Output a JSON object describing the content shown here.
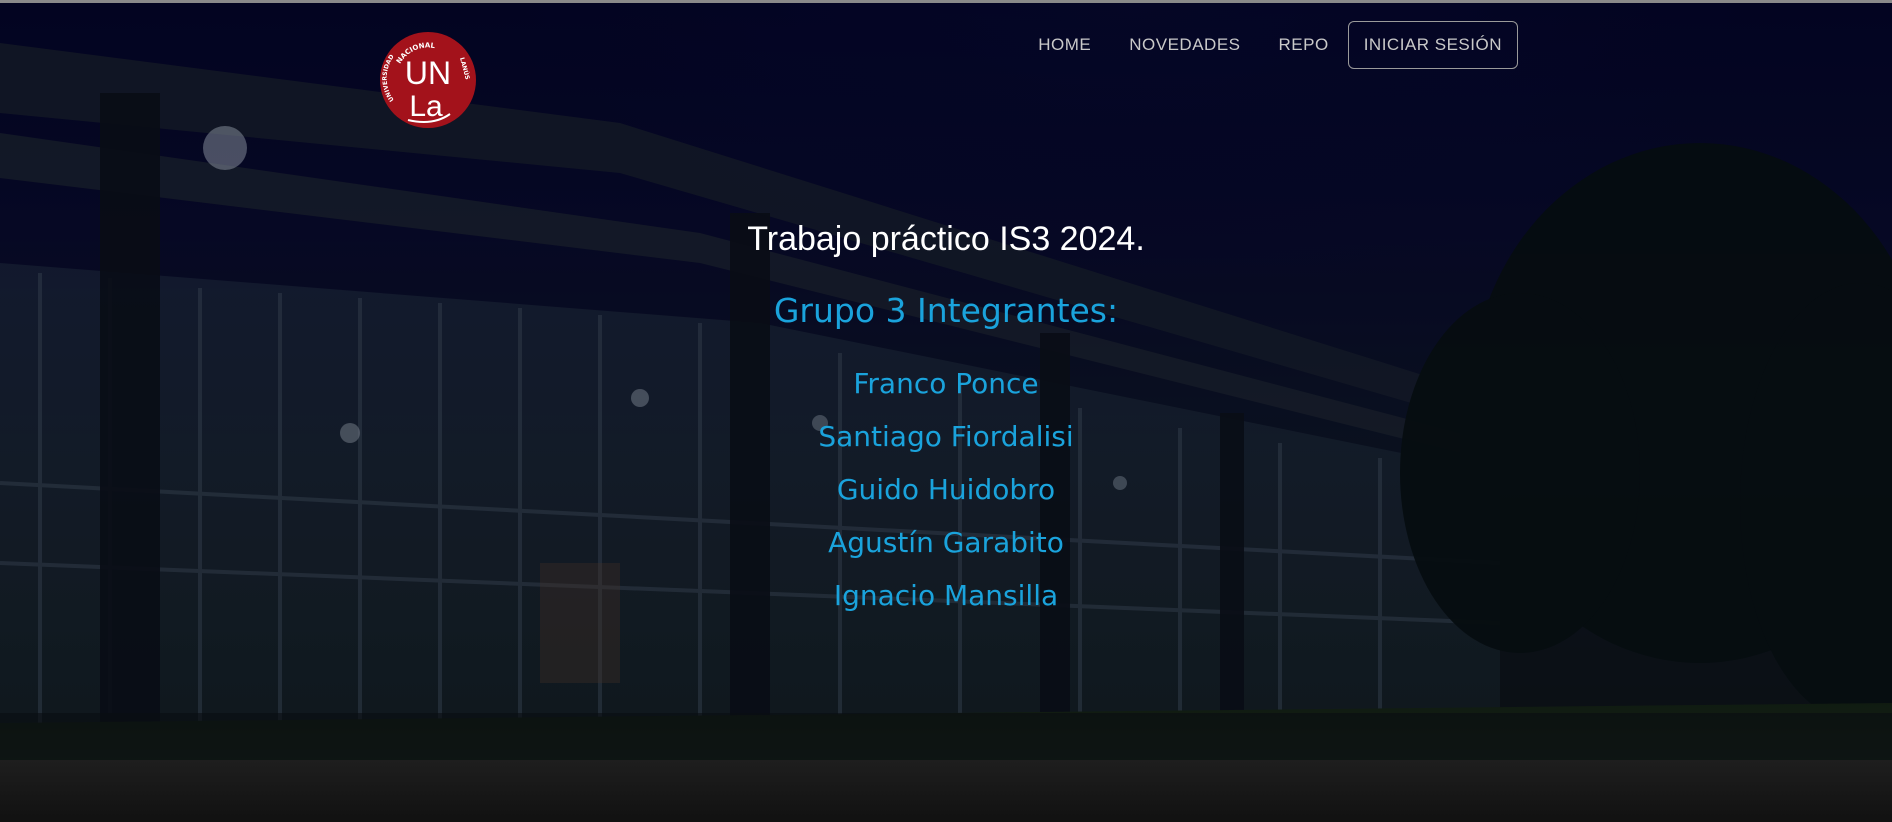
{
  "logo": {
    "letters_top": "UN",
    "letters_bottom": "La",
    "arc_left": "UNIVERSIDAD",
    "arc_top": "NACIONAL",
    "arc_right": "LANÚS",
    "color": "#a3121b"
  },
  "nav": {
    "items": [
      {
        "label": "HOME"
      },
      {
        "label": "NOVEDADES"
      },
      {
        "label": "REPO"
      }
    ],
    "login_label": "INICIAR SESIÓN"
  },
  "hero": {
    "title": "Trabajo práctico IS3 2024.",
    "group_heading": "Grupo 3 Integrantes:",
    "members": [
      "Franco Ponce",
      "Santiago Fiordalisi",
      "Guido Huidobro",
      "Agustín Garabito",
      "Ignacio Mansilla"
    ],
    "accent_color": "#1aa3dc"
  }
}
